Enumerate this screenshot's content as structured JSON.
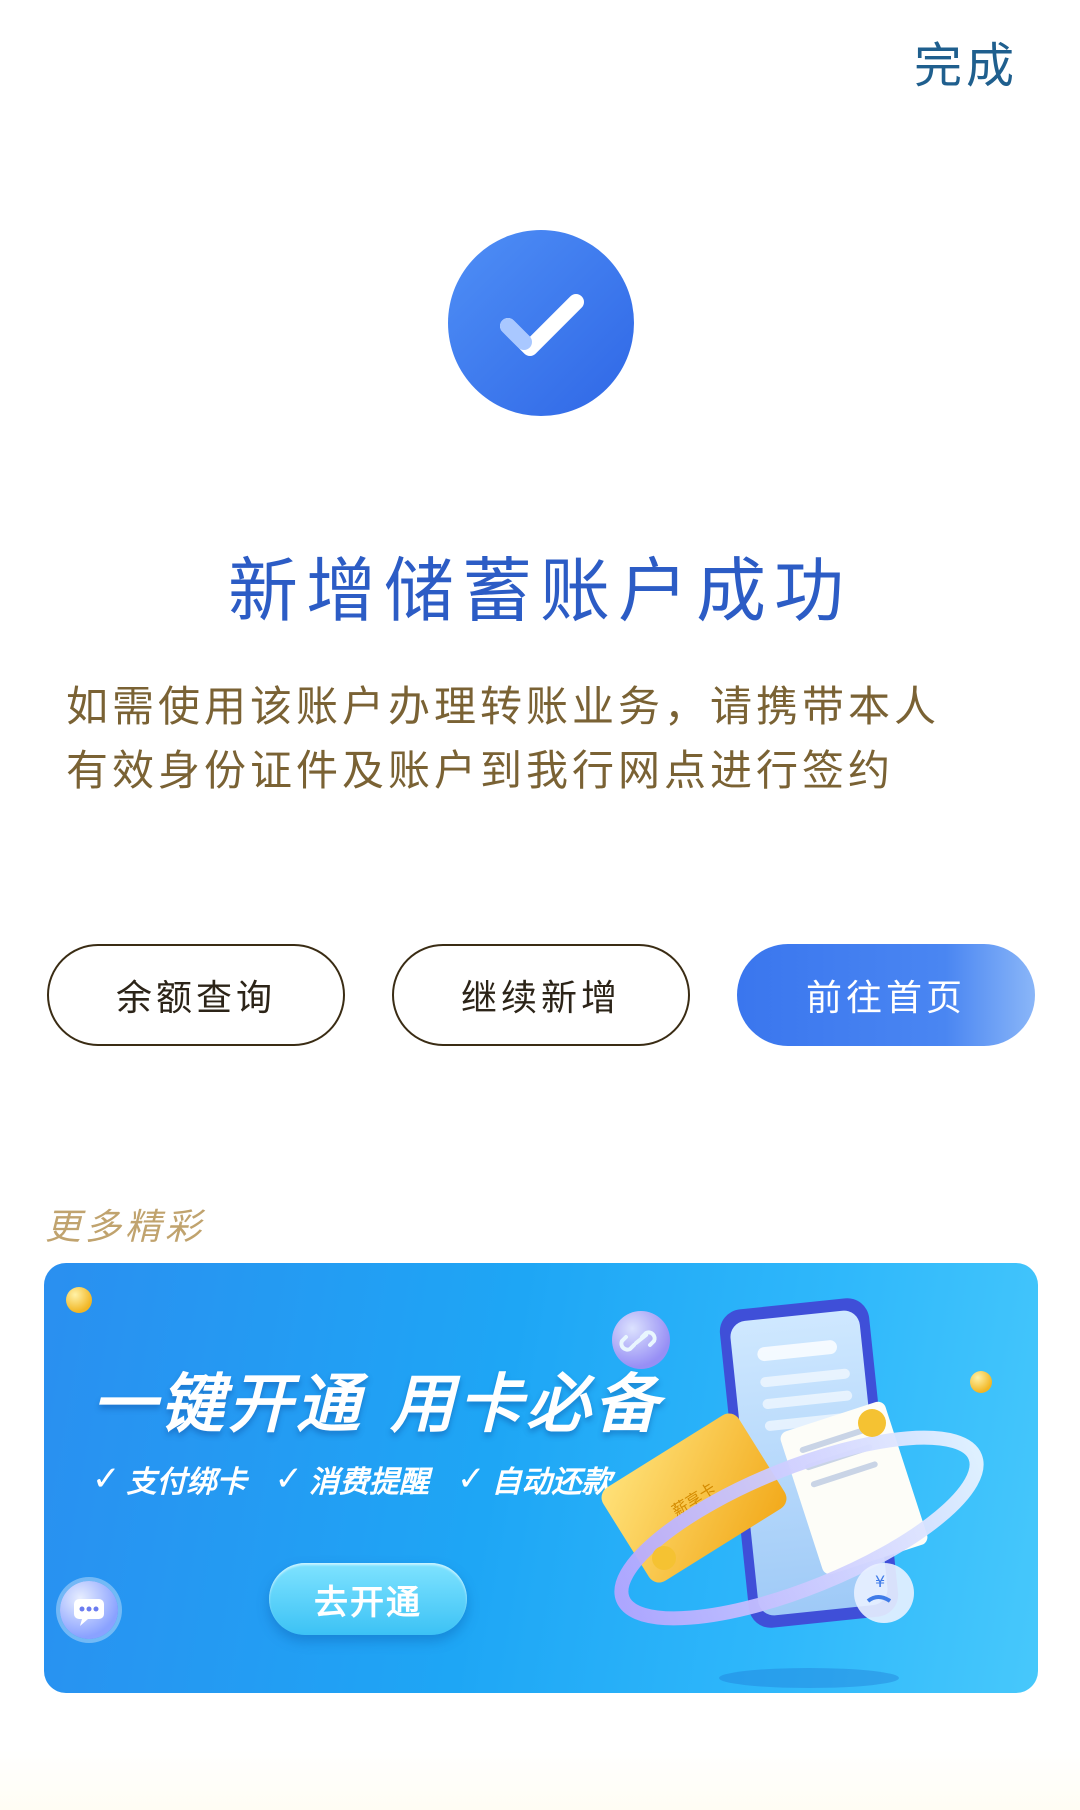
{
  "header": {
    "done_label": "完成"
  },
  "result": {
    "icon": "check-circle-icon",
    "title": "新增储蓄账户成功",
    "description_line1": "如需使用该账户办理转账业务，请携带本人",
    "description_line2": "有效身份证件及账户到我行网点进行签约"
  },
  "actions": {
    "balance_query": "余额查询",
    "continue_add": "继续新增",
    "go_home": "前往首页"
  },
  "more": {
    "label": "更多精彩"
  },
  "banner": {
    "title": "一键开通 用卡必备",
    "features": [
      "支付绑卡",
      "消费提醒",
      "自动还款"
    ],
    "cta": "去开通",
    "card_text": "薪享卡"
  },
  "colors": {
    "primary": "#3a76ee",
    "title_blue": "#2c5cc5",
    "desc_brown": "#7a6234",
    "more_gold": "#c0a36e",
    "done_blue": "#1f5f8e"
  }
}
